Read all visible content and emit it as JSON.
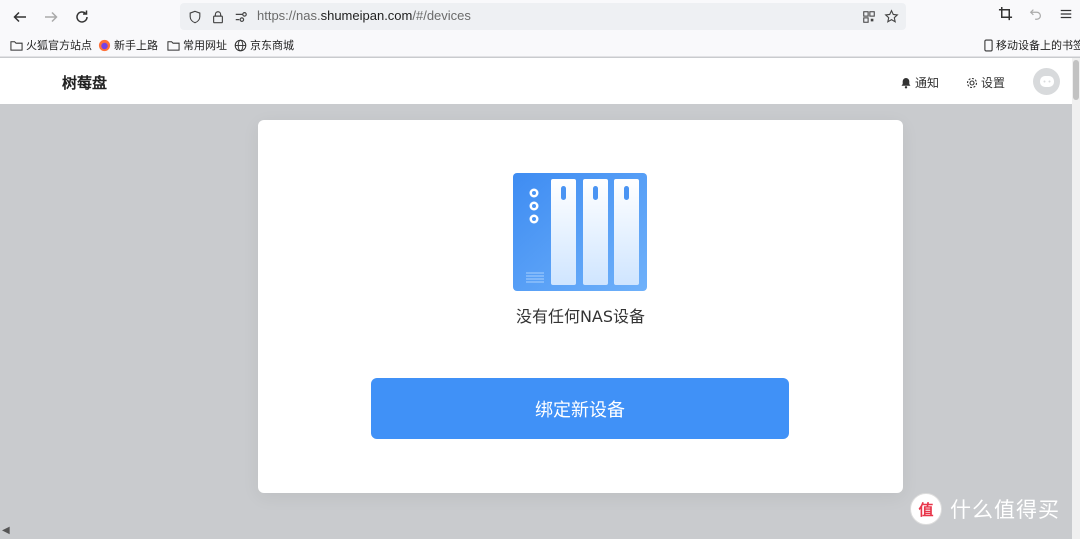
{
  "browser": {
    "url_prefix": "https://nas.",
    "url_domain": "shumeipan.com",
    "url_suffix": "/#/devices",
    "bookmarks": [
      {
        "label": "火狐官方站点",
        "icon": "folder-icon"
      },
      {
        "label": "新手上路",
        "icon": "firefox-icon"
      },
      {
        "label": "常用网址",
        "icon": "folder-icon"
      },
      {
        "label": "京东商城",
        "icon": "globe-icon"
      }
    ],
    "mobile_bookmarks": "移动设备上的书签"
  },
  "app": {
    "brand": "树莓盘",
    "header": {
      "notify_label": "通知",
      "settings_label": "设置"
    }
  },
  "main": {
    "empty_text": "没有任何NAS设备",
    "bind_button_label": "绑定新设备"
  },
  "watermark": {
    "text": "什么值得买",
    "logo_char": "值"
  },
  "colors": {
    "accent": "#4091f7",
    "page_bg": "#c9cbce",
    "card_bg": "#ffffff"
  }
}
